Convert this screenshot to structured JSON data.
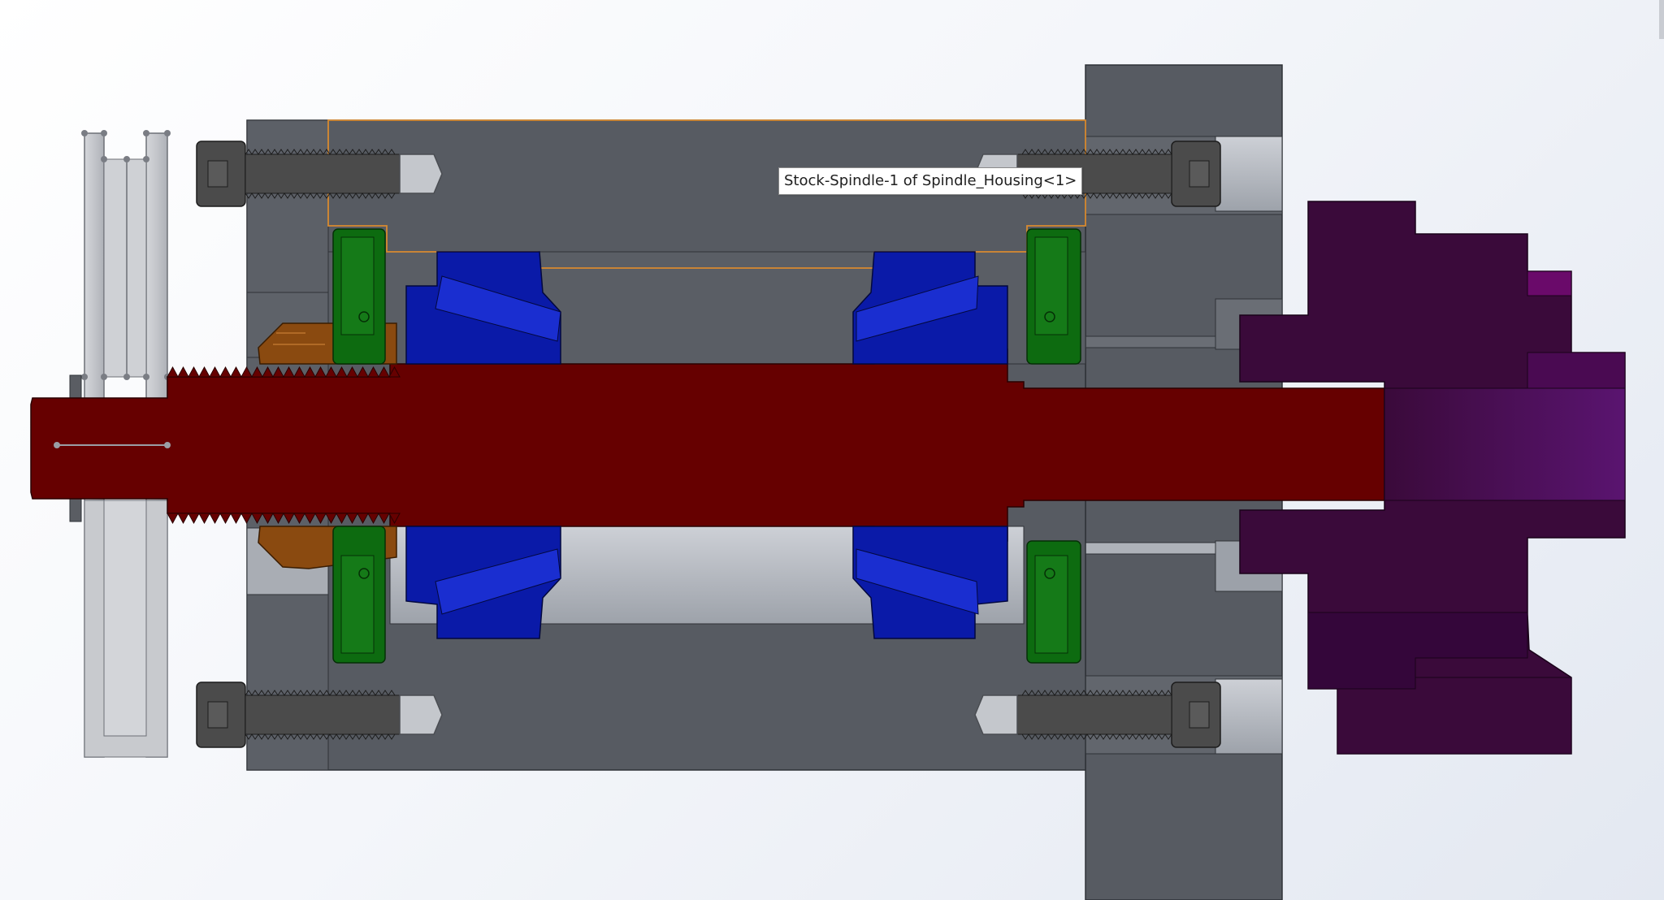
{
  "tooltip": {
    "text": "Stock-Spindle-1 of Spindle_Housing<1>"
  },
  "components": [
    {
      "name": "pulley",
      "color": "#c7c9ce"
    },
    {
      "name": "spindle-housing",
      "color": "#575b62"
    },
    {
      "name": "mounting-plate",
      "color": "#575b62"
    },
    {
      "name": "stock-spindle",
      "color": "#660000"
    },
    {
      "name": "spindle-nut",
      "color": "#8a4a10"
    },
    {
      "name": "tapered-roller-bearing",
      "color": "#0a1aa8"
    },
    {
      "name": "seal",
      "color": "#0d6b10"
    },
    {
      "name": "socket-head-cap-screw",
      "color": "#4b4b4b"
    },
    {
      "name": "chuck-backplate",
      "color": "#3a0a3a"
    },
    {
      "name": "chuck-body",
      "color": "#4b0a60"
    }
  ],
  "colors": {
    "background_top": "#ffffff",
    "background_bottom": "#e3e8f1",
    "housing": "#575b62",
    "spindle": "#660000",
    "bearing": "#0a1aa8",
    "seal": "#0d6b10",
    "nut": "#8a4a10",
    "chuck": "#3a0a3a",
    "selection_outline": "#d88a30"
  }
}
